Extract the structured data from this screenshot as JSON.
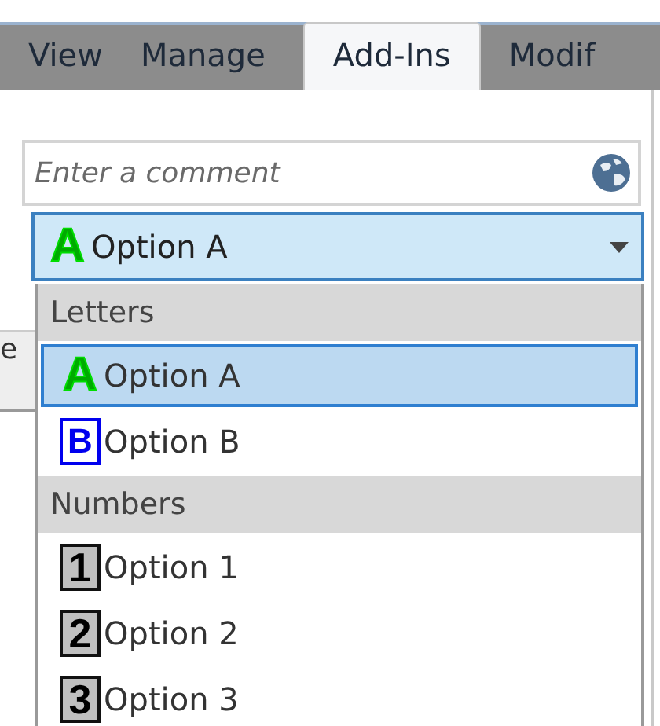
{
  "tabs": [
    {
      "label": "View",
      "selected": false
    },
    {
      "label": "Manage",
      "selected": false
    },
    {
      "label": "Add-Ins",
      "selected": true
    },
    {
      "label": "Modif",
      "selected": false
    }
  ],
  "comment_field": {
    "placeholder": "Enter a comment"
  },
  "background_text": "e",
  "combo": {
    "value": "Option A",
    "glyph": "A",
    "kind": "outline-letter"
  },
  "dropdown": {
    "groups": [
      {
        "header": "Letters",
        "items": [
          {
            "label": "Option A",
            "glyph": "A",
            "kind": "outline-letter",
            "selected": true
          },
          {
            "label": "Option B",
            "glyph": "B",
            "kind": "boxed-letter",
            "selected": false
          }
        ]
      },
      {
        "header": "Numbers",
        "items": [
          {
            "label": "Option 1",
            "glyph": "1",
            "kind": "boxed-number",
            "selected": false
          },
          {
            "label": "Option 2",
            "glyph": "2",
            "kind": "boxed-number",
            "selected": false
          },
          {
            "label": "Option 3",
            "glyph": "3",
            "kind": "boxed-number",
            "selected": false
          }
        ]
      }
    ]
  }
}
